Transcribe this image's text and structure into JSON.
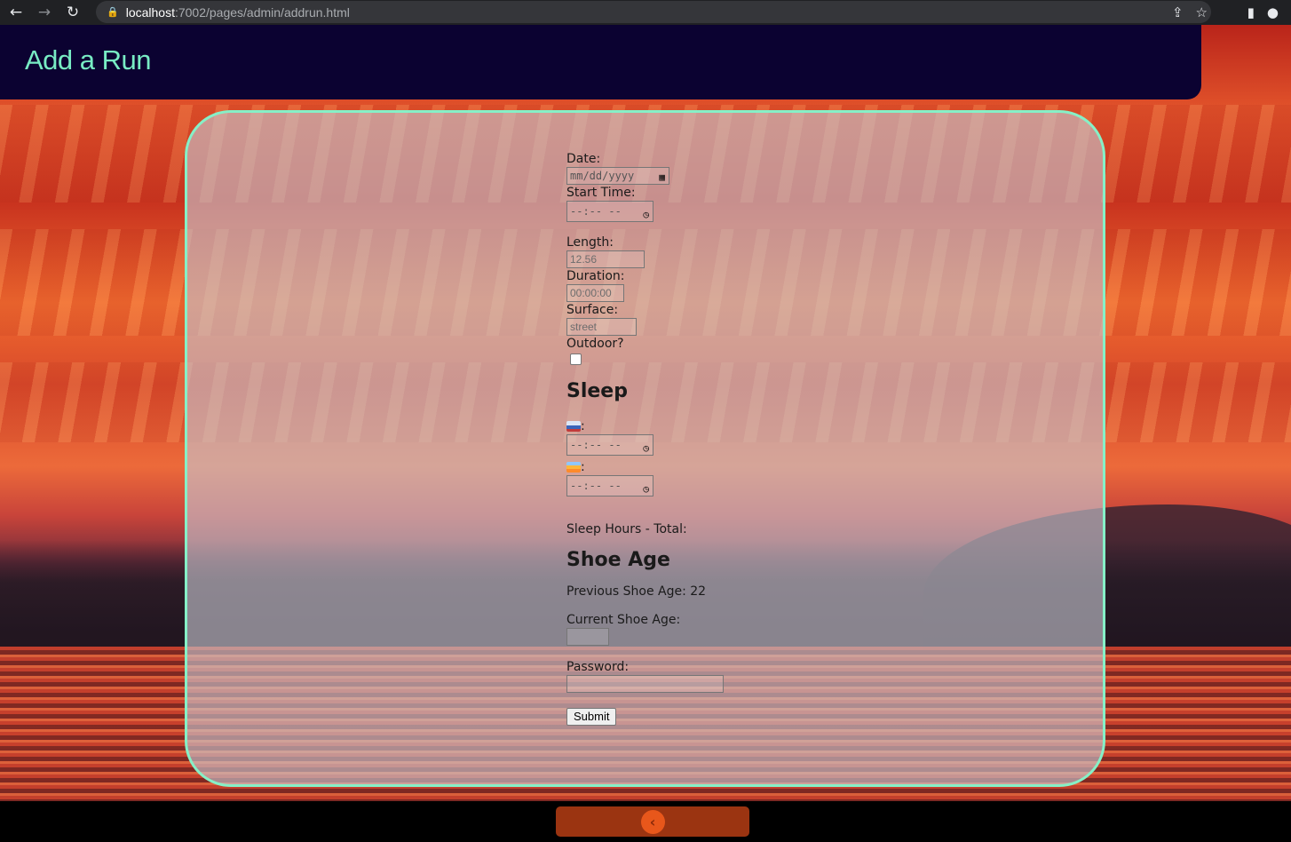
{
  "browser": {
    "url_host": "localhost",
    "url_path": ":7002/pages/admin/addrun.html",
    "back_icon": "←",
    "forward_icon": "→",
    "reload_icon": "↻",
    "lock_icon": "🔒",
    "share_icon": "⇪",
    "star_icon": "☆",
    "sidebar_icon": "▮",
    "profile_icon": "●"
  },
  "header": {
    "title": "Add a Run",
    "title_color": "#78ecc4",
    "background_color": "#0b0231"
  },
  "form": {
    "date_label": "Date:",
    "date_placeholder": "mm/dd/yyyy",
    "start_time_label": "Start Time:",
    "time_placeholder": "--:-- --",
    "length_label": "Length:",
    "length_placeholder": "12.56",
    "duration_label": "Duration:",
    "duration_placeholder": "00:00:00",
    "surface_label": "Surface:",
    "surface_placeholder": "street",
    "outdoor_label": "Outdoor?",
    "sleep_heading": "Sleep",
    "bed_suffix": ":",
    "wake_suffix": ":",
    "sleep_total_label": "Sleep Hours - Total:",
    "shoe_heading": "Shoe Age",
    "previous_shoe_age": "Previous Shoe Age: 22",
    "current_shoe_label": "Current Shoe Age:",
    "password_label": "Password:",
    "submit_label": "Submit"
  },
  "footer": {
    "back_icon": "‹",
    "button_color": "#9b3411"
  }
}
